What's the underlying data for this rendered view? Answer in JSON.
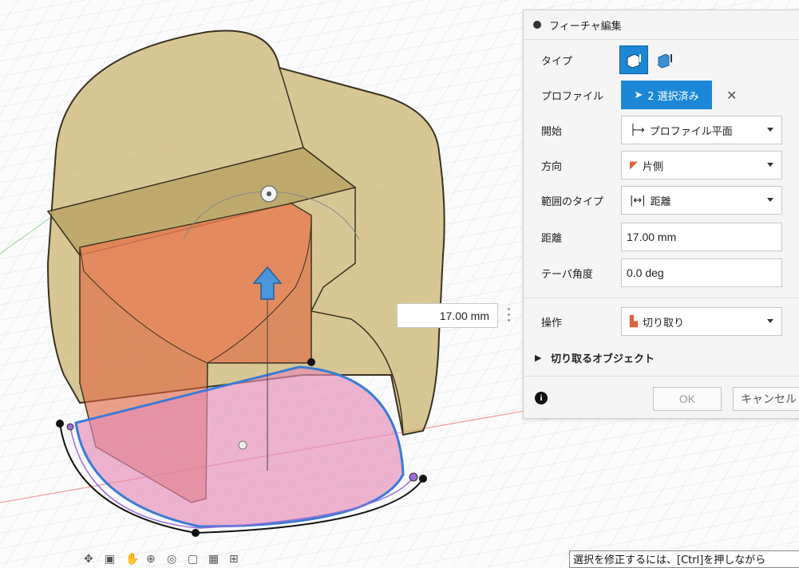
{
  "panel": {
    "title": "フィーチャ編集",
    "type_label": "タイプ",
    "profile_label": "プロファイル",
    "profile_value": "2 選択済み",
    "start_label": "開始",
    "start_value": "プロファイル平面",
    "direction_label": "方向",
    "direction_value": "片側",
    "extent_type_label": "範囲のタイプ",
    "extent_type_value": "距離",
    "distance_label": "距離",
    "distance_value": "17.00 mm",
    "taper_label": "テーパ角度",
    "taper_value": "0.0 deg",
    "operation_label": "操作",
    "operation_value": "切り取り",
    "cut_objects_label": "切り取るオブジェクト",
    "ok_label": "OK",
    "cancel_label": "キャンセル"
  },
  "viewport": {
    "distance_input": "17.00 mm"
  },
  "status": {
    "text": "選択を修正するには、[Ctrl]を押しながら"
  },
  "colors": {
    "accent": "#1c87d6",
    "body_tan": "#c9b06a",
    "cut_red": "#e0623e",
    "profile_pink": "#e58ab6",
    "profile_outline": "#3a7bd5"
  }
}
